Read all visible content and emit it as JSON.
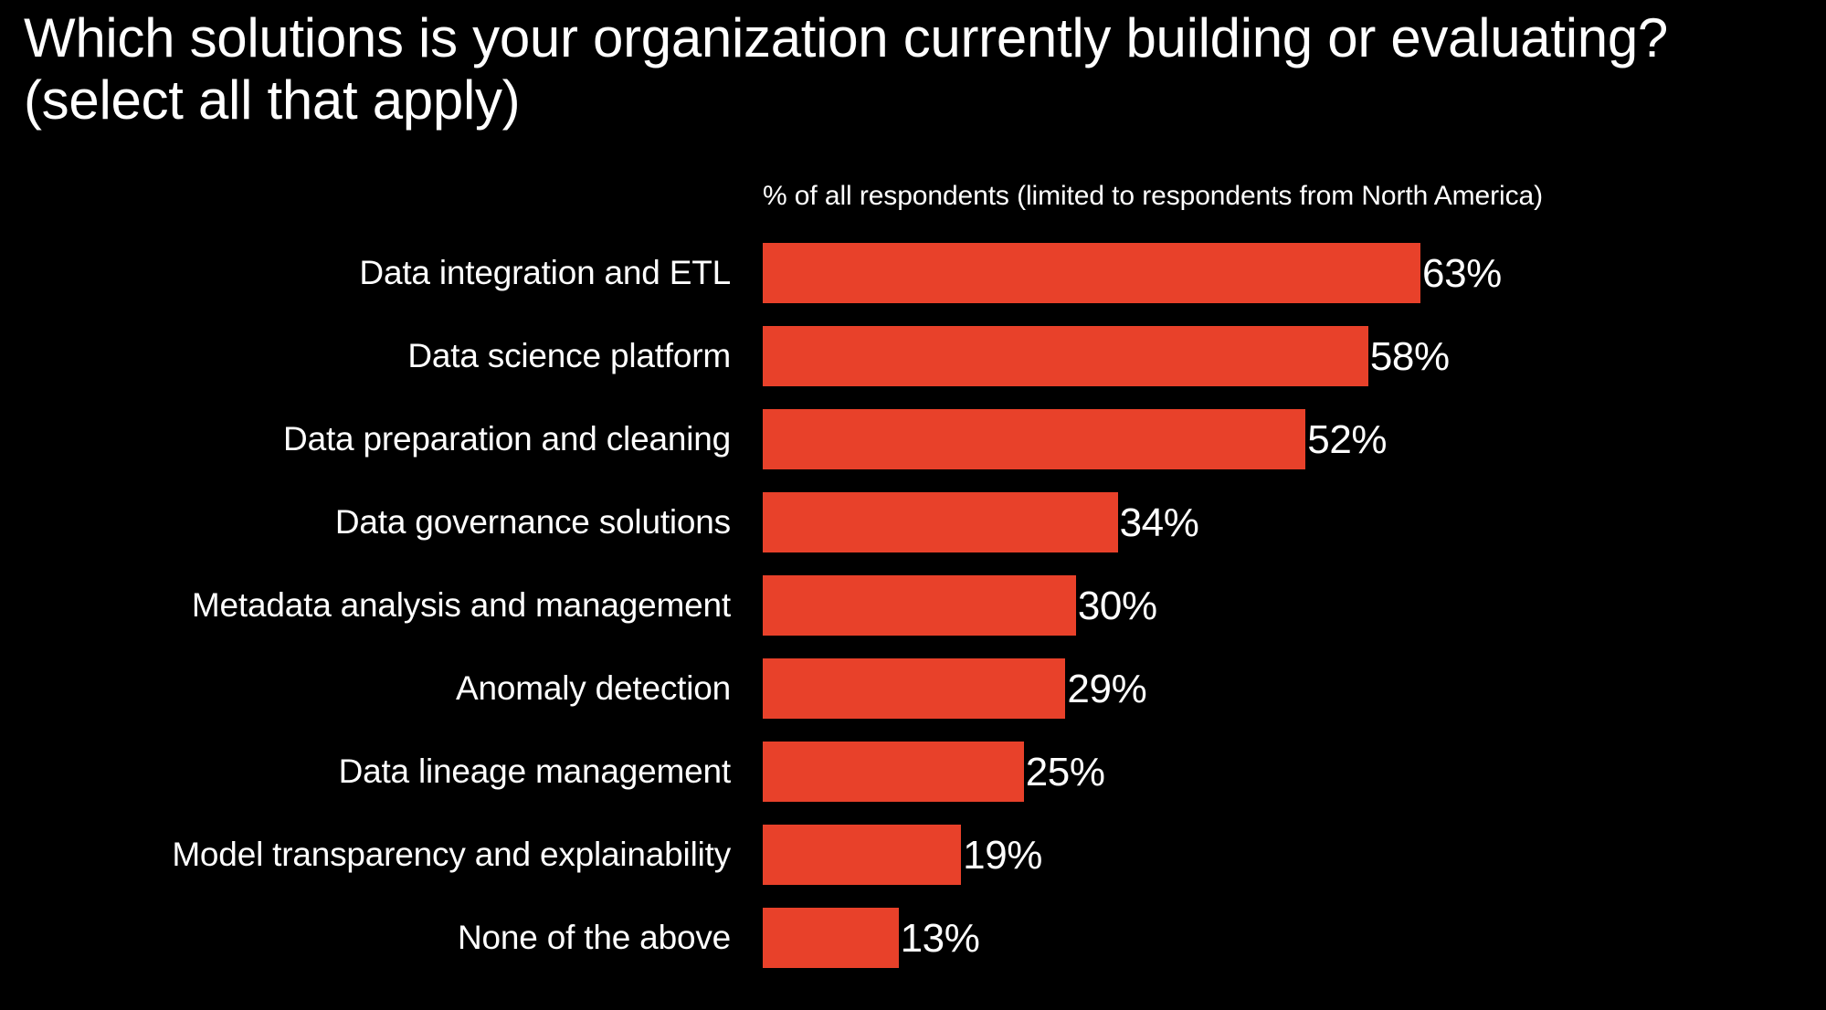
{
  "header": {
    "title": "Which solutions is your organization currently building or evaluating?\n(select all that apply)"
  },
  "axis_note": "% of all respondents (limited to respondents from North America)",
  "style": {
    "background": "#000000",
    "bar_color": "#e8412a",
    "text_color": "#ffffff"
  },
  "chart_data": {
    "type": "bar",
    "orientation": "horizontal",
    "title": "Which solutions is your organization currently building or evaluating? (select all that apply)",
    "subtitle": "% of all respondents (limited to respondents from North America)",
    "xlabel": "% of all respondents (limited to respondents from North America)",
    "ylabel": "",
    "xlim": [
      0,
      63
    ],
    "grid": false,
    "legend": false,
    "value_suffix": "%",
    "categories": [
      "Data integration and ETL",
      "Data science platform",
      "Data preparation and cleaning",
      "Data governance solutions",
      "Metadata analysis and management",
      "Anomaly detection",
      "Data lineage management",
      "Model transparency and explainability",
      "None of the above"
    ],
    "values": [
      63,
      58,
      52,
      34,
      30,
      29,
      25,
      19,
      13
    ],
    "value_labels": [
      "63%",
      "58%",
      "52%",
      "34%",
      "30%",
      "29%",
      "25%",
      "19%",
      "13%"
    ],
    "bars": [
      {
        "label": "Data integration and ETL",
        "value": 63,
        "value_label": "63%"
      },
      {
        "label": "Data science platform",
        "value": 58,
        "value_label": "58%"
      },
      {
        "label": "Data preparation and cleaning",
        "value": 52,
        "value_label": "52%"
      },
      {
        "label": "Data governance solutions",
        "value": 34,
        "value_label": "34%"
      },
      {
        "label": "Metadata analysis and management",
        "value": 30,
        "value_label": "30%"
      },
      {
        "label": "Anomaly detection",
        "value": 29,
        "value_label": "29%"
      },
      {
        "label": "Data lineage management",
        "value": 25,
        "value_label": "25%"
      },
      {
        "label": "Model transparency and explainability",
        "value": 19,
        "value_label": "19%"
      },
      {
        "label": "None of the above",
        "value": 13,
        "value_label": "13%"
      }
    ]
  }
}
